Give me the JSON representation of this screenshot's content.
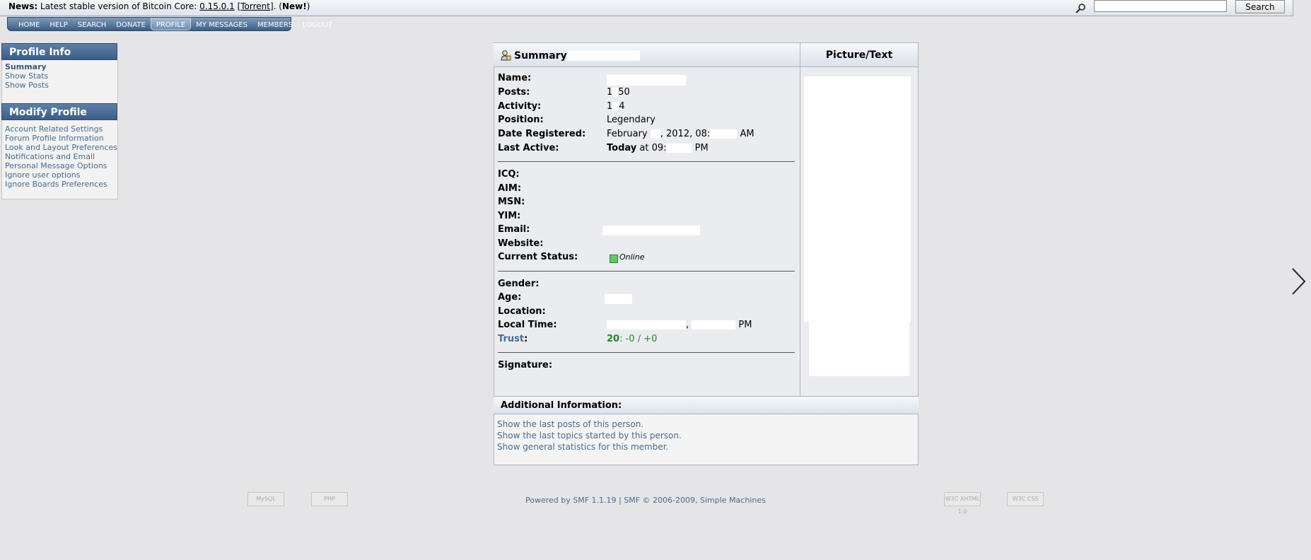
{
  "news": {
    "label": "News:",
    "text_before": " Latest stable version of Bitcoin Core: ",
    "version_link": "0.15.0.1",
    "text_mid": " [",
    "torrent_link": "Torrent",
    "text_after": "]. (",
    "new_label": "New!",
    "close_paren": ")"
  },
  "search": {
    "placeholder": "",
    "button_label": "Search"
  },
  "menu": {
    "items": [
      {
        "label": "HOME"
      },
      {
        "label": "HELP"
      },
      {
        "label": "SEARCH"
      },
      {
        "label": "DONATE"
      },
      {
        "label": "PROFILE"
      },
      {
        "label": "MY MESSAGES"
      },
      {
        "label": "MEMBERS"
      },
      {
        "label": "LOGOUT"
      }
    ]
  },
  "sidebar": {
    "profile_info_title": "Profile Info",
    "profile_info_links": [
      "Summary",
      "Show Stats",
      "Show Posts"
    ],
    "modify_profile_title": "Modify Profile",
    "modify_profile_links": [
      "Account Related Settings",
      "Forum Profile Information",
      "Look and Layout Preferences",
      "Notifications and Email",
      "Personal Message Options",
      "Ignore user options",
      "Ignore Boards Preferences"
    ]
  },
  "summary": {
    "title": "Summary",
    "picture_title": "Picture/Text",
    "fields": {
      "name_label": "Name:",
      "posts_label": "Posts:",
      "posts_value_a": "1",
      "posts_value_b": "50",
      "activity_label": "Activity:",
      "activity_value_a": "1",
      "activity_value_b": "4",
      "position_label": "Position:",
      "position_value": "Legendary",
      "registered_label": "Date Registered:",
      "registered_value_a": "February",
      "registered_value_b": ", 2012, 08:",
      "registered_value_c": "AM",
      "last_active_label": "Last Active:",
      "last_active_today": "Today",
      "last_active_at": " at 09:",
      "last_active_pm": "PM",
      "icq_label": "ICQ:",
      "aim_label": "AIM:",
      "msn_label": "MSN:",
      "yim_label": "YIM:",
      "email_label": "Email:",
      "website_label": "Website:",
      "status_label": "Current Status:",
      "status_value": "Online",
      "gender_label": "Gender:",
      "age_label": "Age:",
      "location_label": "Location:",
      "local_time_label": "Local Time:",
      "local_time_comma": ",",
      "local_time_pm": "PM",
      "trust_label": "Trust",
      "trust_colon": ":",
      "trust_score": "20",
      "trust_detail": ": -0 / +0",
      "signature_label": "Signature:"
    }
  },
  "additional": {
    "title": "Additional Information:",
    "links": [
      "Show the last posts of this person.",
      "Show the last topics started by this person.",
      "Show general statistics for this member."
    ]
  },
  "footer": {
    "powered_by": "Powered by SMF 1.1.19",
    "separator": " | ",
    "copyright": "SMF © 2006-2009, Simple Machines",
    "badges": [
      "MySQL",
      "PHP",
      "W3C XHTML 1.0",
      "W3C CSS"
    ]
  },
  "colors": {
    "link": "#476c8e",
    "header": "#3b5d86",
    "trust_green": "#1f8a1f",
    "online_green": "#6ac46a"
  }
}
